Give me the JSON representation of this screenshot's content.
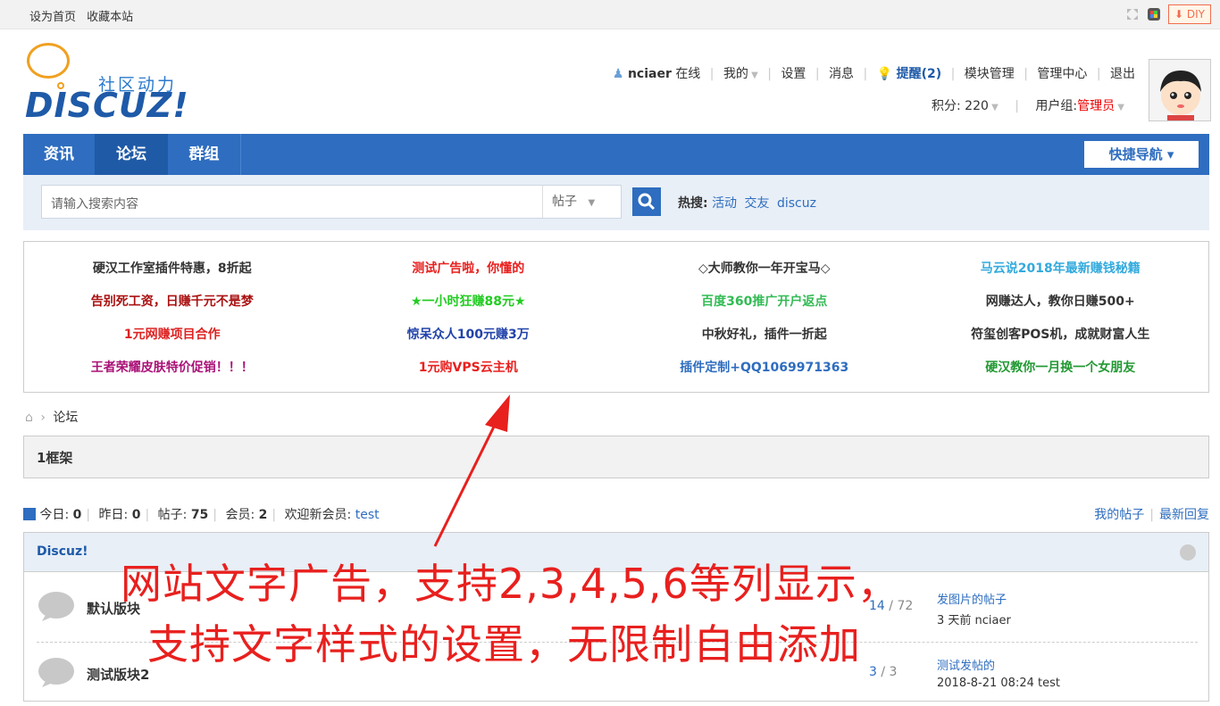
{
  "topbar": {
    "set_home": "设为首页",
    "favorite": "收藏本站",
    "diy": "DIY"
  },
  "logo": {
    "brand": "DISCUZ!",
    "slogan": "社区动力"
  },
  "user": {
    "name": "nciaer",
    "status": "在线",
    "mine": "我的",
    "settings": "设置",
    "messages": "消息",
    "remind": "提醒(2)",
    "module_mgmt": "模块管理",
    "mgmt_center": "管理中心",
    "logout": "退出",
    "points_label": "积分:",
    "points": "220",
    "group_label": "用户组:",
    "group": "管理员"
  },
  "nav": {
    "items": [
      "资讯",
      "论坛",
      "群组"
    ],
    "active": "论坛",
    "quick_nav": "快捷导航"
  },
  "search": {
    "placeholder": "请输入搜索内容",
    "type": "帖子",
    "hot_label": "热搜:",
    "hot": [
      "活动",
      "交友",
      "discuz"
    ]
  },
  "ads": [
    [
      {
        "text": "硬汉工作室插件特惠，8折起",
        "color": "#333333"
      },
      {
        "text": "测试广告啦，你懂的",
        "color": "#e8201e"
      },
      {
        "text": "◇大师教你一年开宝马◇",
        "color": "#333333"
      },
      {
        "text": "马云说2018年最新赚钱秘籍",
        "color": "#33aadd"
      }
    ],
    [
      {
        "text": "告别死工资，日赚千元不是梦",
        "color": "#aa1111"
      },
      {
        "text": "★一小时狂赚88元★",
        "color": "#22cc22"
      },
      {
        "text": "百度360推广开户返点",
        "color": "#33bb55"
      },
      {
        "text": "网赚达人，教你日赚500+",
        "color": "#333333"
      }
    ],
    [
      {
        "text": "1元网赚项目合作",
        "color": "#dd2222"
      },
      {
        "text": "惊呆众人100元赚3万",
        "color": "#2244aa"
      },
      {
        "text": "中秋好礼，插件一折起",
        "color": "#333333"
      },
      {
        "text": "符玺创客POS机，成就财富人生",
        "color": "#333333"
      }
    ],
    [
      {
        "text": "王者荣耀皮肤特价促销！！！",
        "color": "#aa1177"
      },
      {
        "text": "1元购VPS云主机",
        "color": "#e8201e"
      },
      {
        "text": "插件定制+QQ1069971363",
        "color": "#2e6dbf"
      },
      {
        "text": "硬汉教你一月换一个女朋友",
        "color": "#229933"
      }
    ]
  ],
  "breadcrumb": {
    "current": "论坛"
  },
  "frame": {
    "title": "1框架"
  },
  "stats": {
    "today_label": "今日:",
    "today": "0",
    "yesterday_label": "昨日:",
    "yesterday": "0",
    "posts_label": "帖子:",
    "posts": "75",
    "members_label": "会员:",
    "members": "2",
    "welcome_label": "欢迎新会员:",
    "welcome": "test"
  },
  "right_links": {
    "my_posts": "我的帖子",
    "latest": "最新回复"
  },
  "forum": {
    "title": "Discuz!",
    "rows": [
      {
        "name": "默认版块",
        "threads": "14",
        "posts": "72",
        "last_title": "发图片的帖子",
        "last_meta": "3 天前 nciaer"
      },
      {
        "name": "测试版块2",
        "threads": "3",
        "posts": "3",
        "last_title": "测试发帖的",
        "last_meta": "2018-8-21 08:24 test"
      }
    ]
  },
  "overlay": {
    "line1": "网站文字广告，支持2,3,4,5,6等列显示，",
    "line2": "支持文字样式的设置，无限制自由添加"
  }
}
